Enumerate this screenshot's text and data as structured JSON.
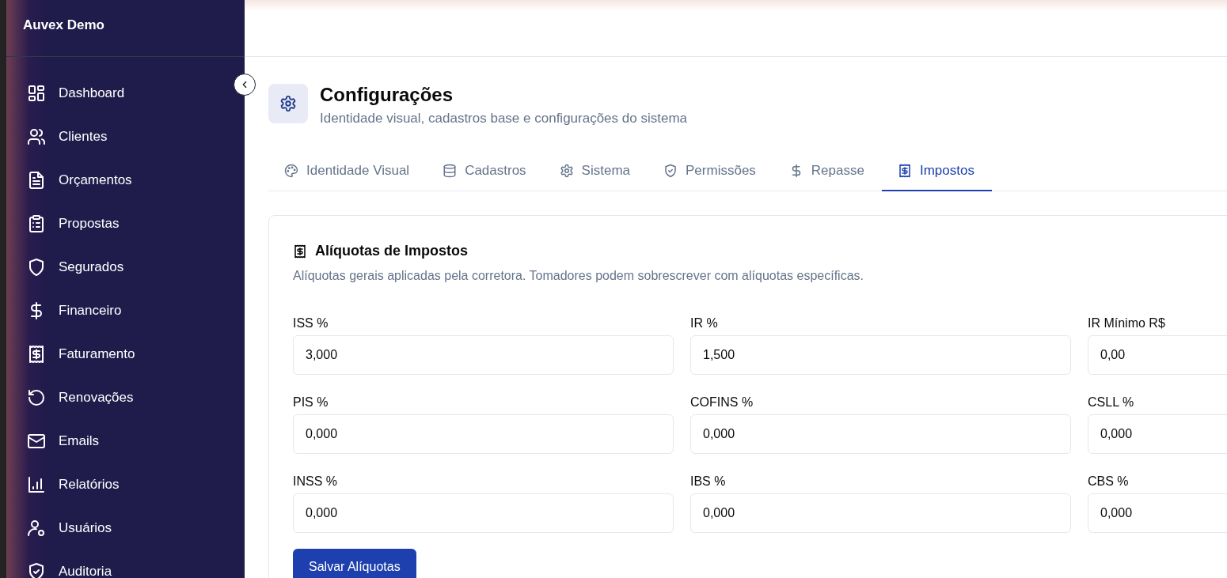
{
  "sidebar": {
    "brand": "Auvex Demo",
    "items": [
      {
        "label": "Dashboard",
        "selected": false
      },
      {
        "label": "Clientes",
        "selected": false
      },
      {
        "label": "Orçamentos",
        "selected": false
      },
      {
        "label": "Propostas",
        "selected": false
      },
      {
        "label": "Segurados",
        "selected": false
      },
      {
        "label": "Financeiro",
        "selected": false
      },
      {
        "label": "Faturamento",
        "selected": false
      },
      {
        "label": "Renovações",
        "selected": false
      },
      {
        "label": "Emails",
        "selected": false
      },
      {
        "label": "Relatórios",
        "selected": false
      },
      {
        "label": "Usuários",
        "selected": false
      },
      {
        "label": "Auditoria",
        "selected": false
      }
    ]
  },
  "page": {
    "title": "Configurações",
    "subtitle": "Identidade visual, cadastros base e configurações do sistema"
  },
  "tabs": [
    {
      "label": "Identidade Visual",
      "selected": false
    },
    {
      "label": "Cadastros",
      "selected": false
    },
    {
      "label": "Sistema",
      "selected": false
    },
    {
      "label": "Permissões",
      "selected": false
    },
    {
      "label": "Repasse",
      "selected": false
    },
    {
      "label": "Impostos",
      "selected": true
    }
  ],
  "card": {
    "title": "Alíquotas de Impostos",
    "description": "Alíquotas gerais aplicadas pela corretora. Tomadores podem sobrescrever com alíquotas específicas.",
    "fields": [
      {
        "label": "ISS %",
        "value": "3,000"
      },
      {
        "label": "IR %",
        "value": "1,500"
      },
      {
        "label": "IR Mínimo R$",
        "value": "0,00"
      },
      {
        "label": "PIS %",
        "value": "0,000"
      },
      {
        "label": "COFINS %",
        "value": "0,000"
      },
      {
        "label": "CSLL %",
        "value": "0,000"
      },
      {
        "label": "INSS %",
        "value": "0,000"
      },
      {
        "label": "IBS %",
        "value": "0,000"
      },
      {
        "label": "CBS %",
        "value": "0,000"
      }
    ],
    "save_button": "Salvar Alíquotas"
  }
}
